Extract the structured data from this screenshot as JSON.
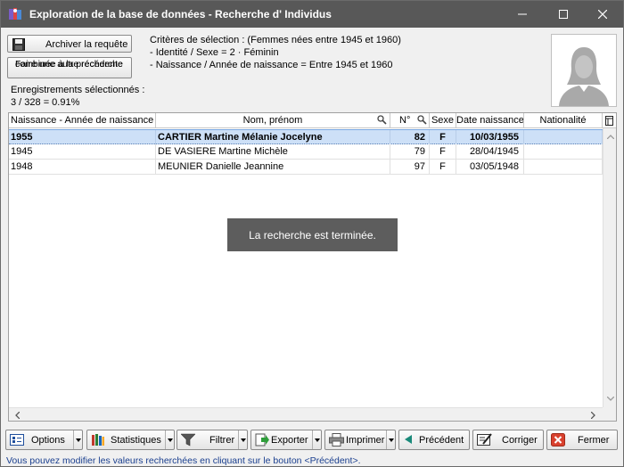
{
  "window": {
    "title": "Exploration de la base de données - Recherche d' Individus",
    "controls": [
      "minimize-icon",
      "maximize-icon",
      "close-icon"
    ]
  },
  "actions": {
    "archive_label": "Archiver la requête",
    "combine_label_line1": "Faire une autre recherche",
    "combine_label_line2": "combinée à la précédente"
  },
  "criteria": {
    "line1": "Critères de sélection : (Femmes nées entre 1945 et 1960)",
    "line2": "- Identité / Sexe  = 2 · Féminin",
    "line3": "- Naissance / Année de naissance  = Entre 1945 et 1960"
  },
  "selection": {
    "label": "Enregistrements sélectionnés :",
    "value": "3 / 328  = 0.91%"
  },
  "table": {
    "columns": [
      "Naissance - Année de naissance",
      "Nom, prénom",
      "N°",
      "Sexe",
      "Date naissance",
      "Nationalité"
    ],
    "rows": [
      [
        "1955",
        "CARTIER Martine Mélanie Jocelyne",
        "82",
        "F",
        "10/03/1955",
        ""
      ],
      [
        "1945",
        "DE VASIERE Martine Michèle",
        "79",
        "F",
        "28/04/1945",
        ""
      ],
      [
        "1948",
        "MEUNIER Danielle Jeannine",
        "97",
        "F",
        "03/05/1948",
        ""
      ]
    ]
  },
  "toast": "La recherche est terminée.",
  "toolbar": {
    "options": "Options",
    "statistiques": "Statistiques",
    "filtrer": "Filtrer",
    "exporter": "Exporter",
    "imprimer": "Imprimer",
    "precedent": "Précédent",
    "corriger": "Corriger",
    "fermer": "Fermer"
  },
  "status_text": "Vous pouvez modifier les valeurs recherchées en cliquant sur le bouton <Précédent>.",
  "colors": {
    "titlebar": "#585858",
    "selected_row": "#cde0f7",
    "status_text": "#1a3f8f",
    "toast_bg": "#5d5d5d"
  }
}
